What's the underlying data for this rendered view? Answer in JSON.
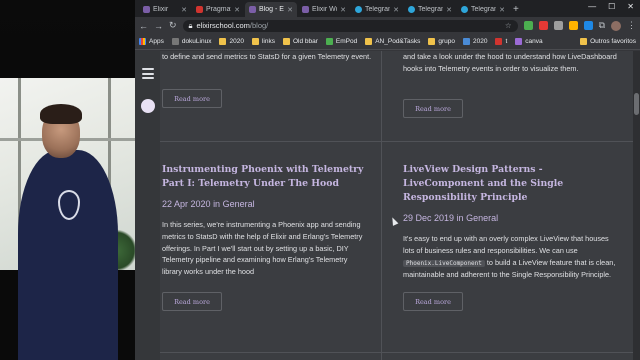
{
  "tabs": [
    {
      "label": "Elixir",
      "icon": "elixir-favicon",
      "active": false
    },
    {
      "label": "Pragmat",
      "icon": "pragmatic-favicon",
      "active": false
    },
    {
      "label": "Blog - Eli",
      "icon": "elixir-favicon",
      "active": true
    },
    {
      "label": "Elixir Wo",
      "icon": "elixir-favicon",
      "active": false
    },
    {
      "label": "Telegram",
      "icon": "telegram-favicon",
      "active": false
    },
    {
      "label": "Telegram",
      "icon": "telegram-favicon",
      "active": false
    },
    {
      "label": "Telegram",
      "icon": "telegram-favicon",
      "active": false
    }
  ],
  "toolbar": {
    "domain": "elixirschool.com",
    "path": "/blog/"
  },
  "bookmarks": [
    {
      "label": "Apps",
      "icon": "apps-grid-icon"
    },
    {
      "label": "dokuLinux",
      "icon": "bookmark-icon"
    },
    {
      "label": "2020",
      "icon": "folder-icon"
    },
    {
      "label": "links",
      "icon": "folder-icon"
    },
    {
      "label": "Old bbar",
      "icon": "folder-icon"
    },
    {
      "label": "EmPod",
      "icon": "bookmark-icon"
    },
    {
      "label": "AN_Pod&Tasks",
      "icon": "folder-icon"
    },
    {
      "label": "grupo",
      "icon": "folder-icon"
    },
    {
      "label": "2020",
      "icon": "folder-icon"
    },
    {
      "label": "t",
      "icon": "bookmark-icon"
    },
    {
      "label": "canva",
      "icon": "bookmark-icon"
    },
    {
      "label": "Outros favoritos",
      "icon": "folder-icon"
    }
  ],
  "cards": {
    "top_left": {
      "excerpt": "to define and send metrics to StatsD for a given Telemetry event.",
      "button": "Read more"
    },
    "top_right": {
      "excerpt": "and take a look under the hood to understand how LiveDashboard hooks into Telemetry events in order to visualize them.",
      "button": "Read more"
    },
    "mid_left": {
      "title": "Instrumenting Phoenix with Telemetry Part I: Telemetry Under The Hood",
      "date": "22 Apr 2020",
      "in": "in",
      "category": "General",
      "excerpt": "In this series, we're instrumenting a Phoenix app and sending metrics to StatsD with the help of Elixir and Erlang's Telemetry offerings. In Part I we'll start out by setting up a basic, DIY Telemetry pipeline and examining how Erlang's Telemetry library works under the hood",
      "button": "Read more"
    },
    "mid_right": {
      "title": "LiveView Design Patterns - LiveComponent and the Single Responsibility Principle",
      "date": "29 Dec 2019",
      "in": "in",
      "category": "General",
      "excerpt_before": "It's easy to end up with an overly complex LiveView that houses lots of business rules and responsibilities. We can use",
      "excerpt_code": "Phoenix.LiveComponent",
      "excerpt_after": "to build a LiveView feature that is clean, maintainable and adherent to the Single Responsibility Principle.",
      "button": "Read more"
    }
  },
  "colors": {
    "page_bg": "#3b3d41",
    "title_purple": "#c5b6e0",
    "chrome_dark": "#202124"
  }
}
